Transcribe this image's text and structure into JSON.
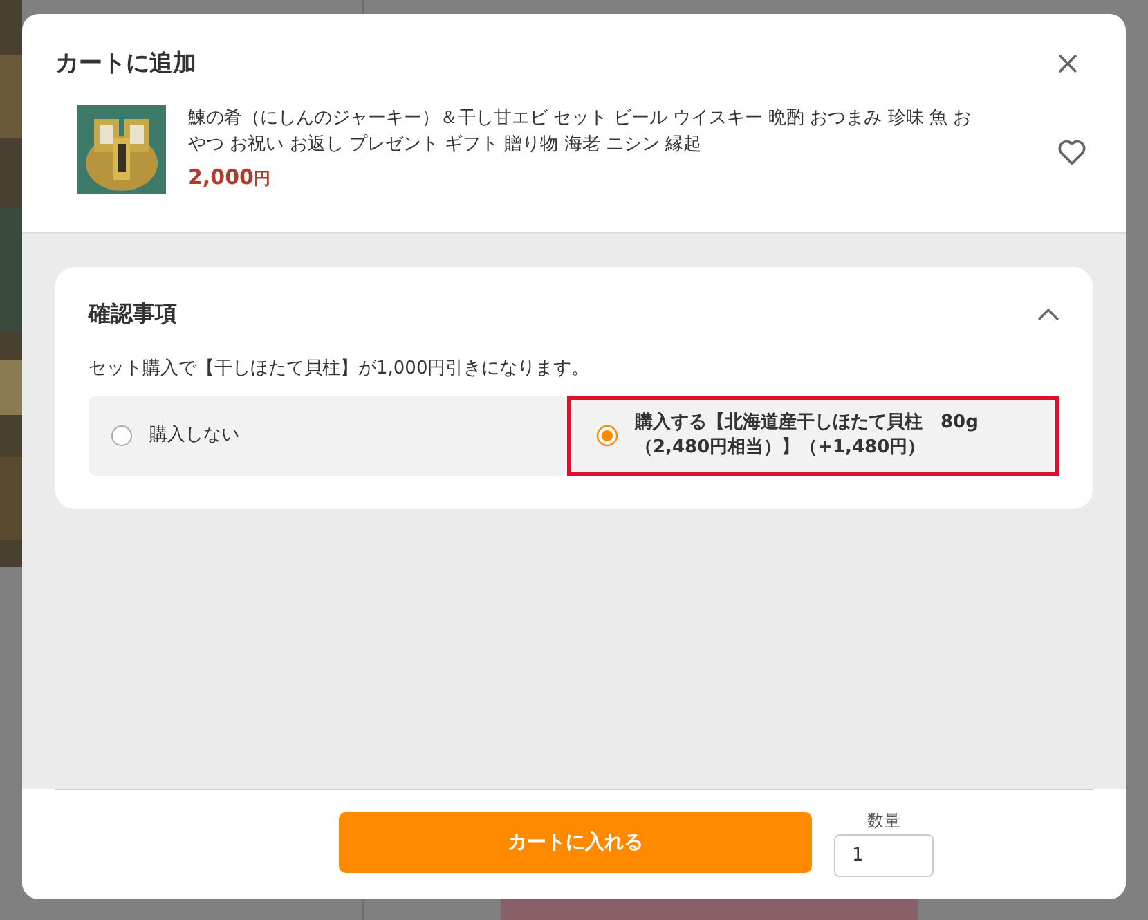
{
  "dialog": {
    "title": "カートに追加"
  },
  "product": {
    "name": "鰊の肴（にしんのジャーキー）＆干し甘エビ セット ビール ウイスキー 晩酌 おつまみ 珍味 魚 おやつ お祝い お返し プレゼント ギフト 贈り物 海老 ニシン 縁起",
    "price": "2,000",
    "currency": "円",
    "favorite": false
  },
  "confirmation": {
    "title": "確認事項",
    "expanded": true,
    "note": "セット購入で【干しほたて貝柱】が1,000円引きになります。",
    "options": [
      {
        "label": "購入しない",
        "selected": false
      },
      {
        "label": "購入する【北海道産干しほたて貝柱　80g（2,480円相当）】（+1,480円）",
        "selected": true
      }
    ]
  },
  "footer": {
    "add_button": "カートに入れる",
    "quantity_label": "数量",
    "quantity": "1"
  }
}
